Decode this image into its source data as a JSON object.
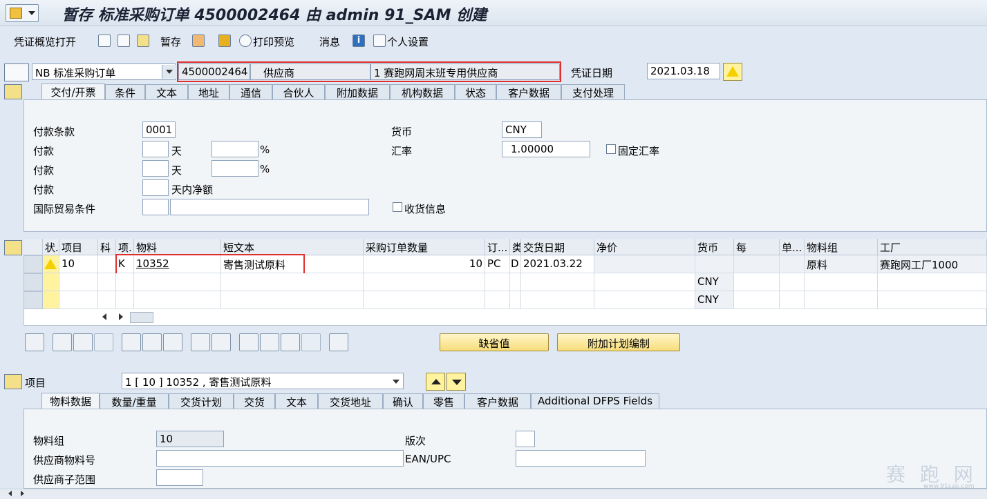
{
  "window": {
    "title": "暂存 标准采购订单 4500002464 由 admin 91_SAM 创建"
  },
  "toolbar": {
    "doc_overview": "凭证概览打开",
    "hold": "暂存",
    "print_preview": "打印预览",
    "messages": "消息",
    "personal_settings": "个人设置"
  },
  "header": {
    "doc_type": "NB 标准采购订单",
    "po_number": "4500002464",
    "vendor_label": "供应商",
    "vendor_value": "1 赛跑网周末班专用供应商",
    "doc_date_label": "凭证日期",
    "doc_date": "2021.03.18"
  },
  "header_tabs": [
    "交付/开票",
    "条件",
    "文本",
    "地址",
    "通信",
    "合伙人",
    "附加数据",
    "机构数据",
    "状态",
    "客户数据",
    "支付处理"
  ],
  "delivery": {
    "payment_terms_label": "付款条款",
    "payment_terms": "0001",
    "payment_label": "付款",
    "days": "天",
    "percent": "%",
    "net_days": "天内净额",
    "incoterms_label": "国际贸易条件",
    "gr_message": "收货信息",
    "currency_label": "货币",
    "currency": "CNY",
    "exchange_rate_label": "汇率",
    "exchange_rate": "1.00000",
    "fixed_rate": "固定汇率"
  },
  "items_table": {
    "headers": [
      "状.",
      "项目",
      "科",
      "项.",
      "物料",
      "短文本",
      "采购订单数量",
      "订...",
      "类",
      "交货日期",
      "净价",
      "货币",
      "每",
      "单...",
      "物料组",
      "工厂"
    ],
    "rows": [
      {
        "item": "10",
        "category": "K",
        "material": "10352",
        "short_text": "寄售测试原料",
        "qty": "10",
        "unit": "PC",
        "date_cat": "D",
        "delivery_date": "2021.03.22",
        "currency": "",
        "mat_group": "原料",
        "plant": "赛跑网工厂1000"
      },
      {
        "currency": "CNY"
      },
      {
        "currency": "CNY"
      }
    ]
  },
  "item_buttons": {
    "default_values": "缺省值",
    "additional_planning": "附加计划编制"
  },
  "item_detail": {
    "label": "项目",
    "selected": "1 [ 10 ] 10352 , 寄售测试原料",
    "tabs": [
      "物料数据",
      "数量/重量",
      "交货计划",
      "交货",
      "文本",
      "交货地址",
      "确认",
      "零售",
      "客户数据",
      "Additional DFPS Fields"
    ],
    "material_group_label": "物料组",
    "material_group": "10",
    "revision_label": "版次",
    "vendor_material_label": "供应商物料号",
    "ean_label": "EAN/UPC",
    "vendor_subrange_label": "供应商子范围"
  },
  "watermark": {
    "text": "赛 跑 网",
    "url": "www.91sap.com"
  }
}
